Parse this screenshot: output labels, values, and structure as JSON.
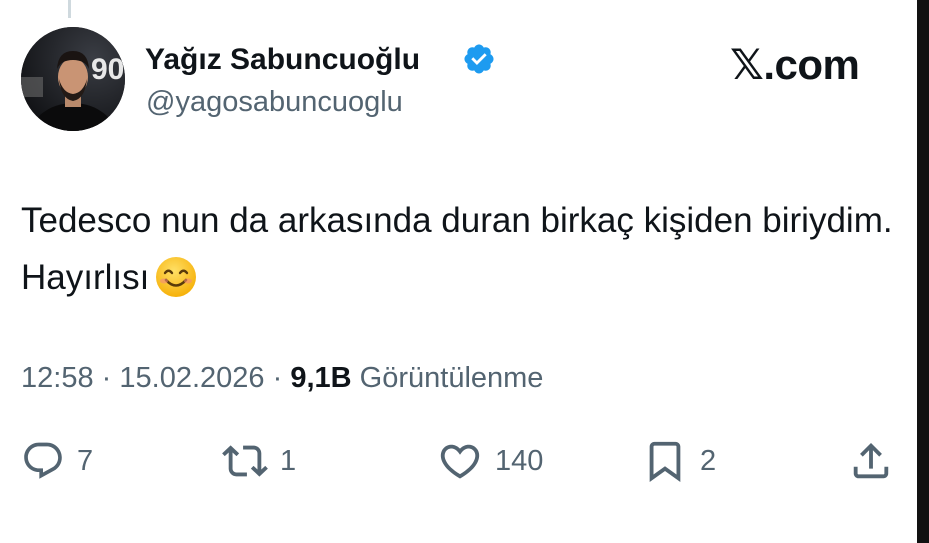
{
  "author": {
    "name": "Yağız Sabuncuoğlu",
    "handle": "@yagosabuncuoglu",
    "verified": true,
    "avatar_icon": "profile-photo",
    "avatar_background_text": "90"
  },
  "site": {
    "logo": "𝕏.com"
  },
  "tweet": {
    "text": "Tedesco nun da arkasında duran birkaç kişiden biriydim. Hayırlısı",
    "emoji": "smiling-face-emoji"
  },
  "meta": {
    "time": "12:58",
    "separator": "·",
    "date": "15.02.2026",
    "views_count": "9,1B",
    "views_label": "Görüntülenme"
  },
  "actions": {
    "reply_count": "7",
    "retweet_count": "1",
    "like_count": "140",
    "bookmark_count": "2"
  },
  "icons": {
    "reply": "reply-icon",
    "retweet": "retweet-icon",
    "like": "heart-icon",
    "bookmark": "bookmark-icon",
    "share": "share-icon",
    "verified": "verified-badge-icon"
  },
  "colors": {
    "text": "#0f1419",
    "secondary_text": "#536471",
    "verified_blue": "#1d9bf0",
    "background": "#ffffff"
  }
}
